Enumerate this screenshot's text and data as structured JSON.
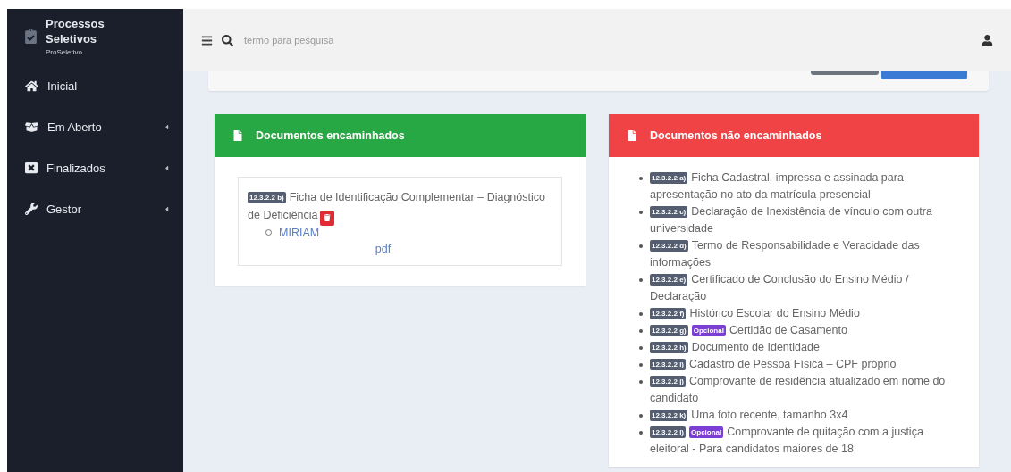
{
  "sidebar": {
    "brand": {
      "title": "Processos Seletivos",
      "subtitle": "ProSeletivo"
    },
    "items": [
      {
        "label": "Inicial",
        "has_submenu": false
      },
      {
        "label": "Em Aberto",
        "has_submenu": true
      },
      {
        "label": "Finalizados",
        "has_submenu": true
      },
      {
        "label": "Gestor",
        "has_submenu": true
      }
    ]
  },
  "header": {
    "search": {
      "placeholder": "termo para pesquisa"
    }
  },
  "panels": [
    {
      "kind": "sent",
      "title": "Documentos encaminhados",
      "documents": [
        {
          "code": "12.3.2.2 b)",
          "title": "Ficha de Identificação Complementar – Diagnóstico de Deficiência",
          "submissions": [
            {
              "name": "MIRIAM",
              "file": "pdf"
            }
          ]
        }
      ]
    },
    {
      "kind": "missing",
      "title": "Documentos não encaminhados",
      "documents": [
        {
          "code": "12.3.2.2 a)",
          "title": "Ficha Cadastral, impressa e assinada para apresentação no ato da matrícula presencial"
        },
        {
          "code": "12.3.2.2 c)",
          "title": "Declaração de Inexistência de vínculo com outra universidade"
        },
        {
          "code": "12.3.2.2 d)",
          "title": "Termo de Responsabilidade e Veracidade das informações"
        },
        {
          "code": "12.3.2.2 e)",
          "title": "Certificado de Conclusão do Ensino Médio / Declaração"
        },
        {
          "code": "12.3.2.2 f)",
          "title": "Histórico Escolar do Ensino Médio"
        },
        {
          "code": "12.3.2.2 g)",
          "tag": "Opcional",
          "title": "Certidão de Casamento"
        },
        {
          "code": "12.3.2.2 h)",
          "title": "Documento de Identidade"
        },
        {
          "code": "12.3.2.2 i)",
          "title": "Cadastro de Pessoa Física – CPF próprio"
        },
        {
          "code": "12.3.2.2 j)",
          "title": "Comprovante de residência atualizado em nome do candidato"
        },
        {
          "code": "12.3.2.2 k)",
          "title": "Uma foto recente, tamanho 3x4"
        },
        {
          "code": "12.3.2.2 l)",
          "tag": "Opcional",
          "title": "Comprovante de quitação com a justiça eleitoral - Para candidatos maiores de 18"
        }
      ]
    }
  ]
}
